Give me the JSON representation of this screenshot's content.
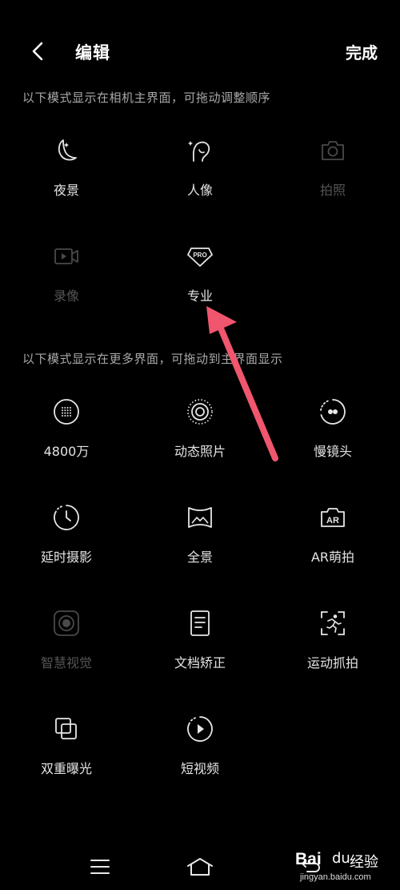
{
  "header": {
    "title": "编辑",
    "done_label": "完成"
  },
  "sections": {
    "main_label": "以下模式显示在相机主界面，可拖动调整顺序",
    "more_label": "以下模式显示在更多界面，可拖动到主界面显示"
  },
  "main_modes": [
    {
      "label": "夜景",
      "icon": "moon-icon",
      "enabled": true
    },
    {
      "label": "人像",
      "icon": "portrait-icon",
      "enabled": true
    },
    {
      "label": "拍照",
      "icon": "camera-icon",
      "enabled": false
    },
    {
      "label": "录像",
      "icon": "video-icon",
      "enabled": false
    },
    {
      "label": "专业",
      "icon": "pro-icon",
      "enabled": true
    }
  ],
  "more_modes": [
    {
      "label": "4800万",
      "icon": "dotted-circle-icon",
      "enabled": true
    },
    {
      "label": "动态照片",
      "icon": "live-photo-icon",
      "enabled": true
    },
    {
      "label": "慢镜头",
      "icon": "slow-motion-icon",
      "enabled": true
    },
    {
      "label": "延时摄影",
      "icon": "timelapse-icon",
      "enabled": true
    },
    {
      "label": "全景",
      "icon": "panorama-icon",
      "enabled": true
    },
    {
      "label": "AR萌拍",
      "icon": "ar-icon",
      "enabled": true
    },
    {
      "label": "智慧视觉",
      "icon": "smart-vision-icon",
      "enabled": false
    },
    {
      "label": "文档矫正",
      "icon": "document-icon",
      "enabled": true
    },
    {
      "label": "运动抓拍",
      "icon": "sport-icon",
      "enabled": true
    },
    {
      "label": "双重曝光",
      "icon": "double-exposure-icon",
      "enabled": true
    },
    {
      "label": "短视频",
      "icon": "short-video-icon",
      "enabled": true
    }
  ],
  "watermark": {
    "brand": "Bai",
    "paw": "du",
    "jingyan": "经验",
    "url": "jingyan.baidu.com"
  },
  "colors": {
    "background": "#000000",
    "arrow": "#f0566e",
    "disabled": "#555555"
  }
}
